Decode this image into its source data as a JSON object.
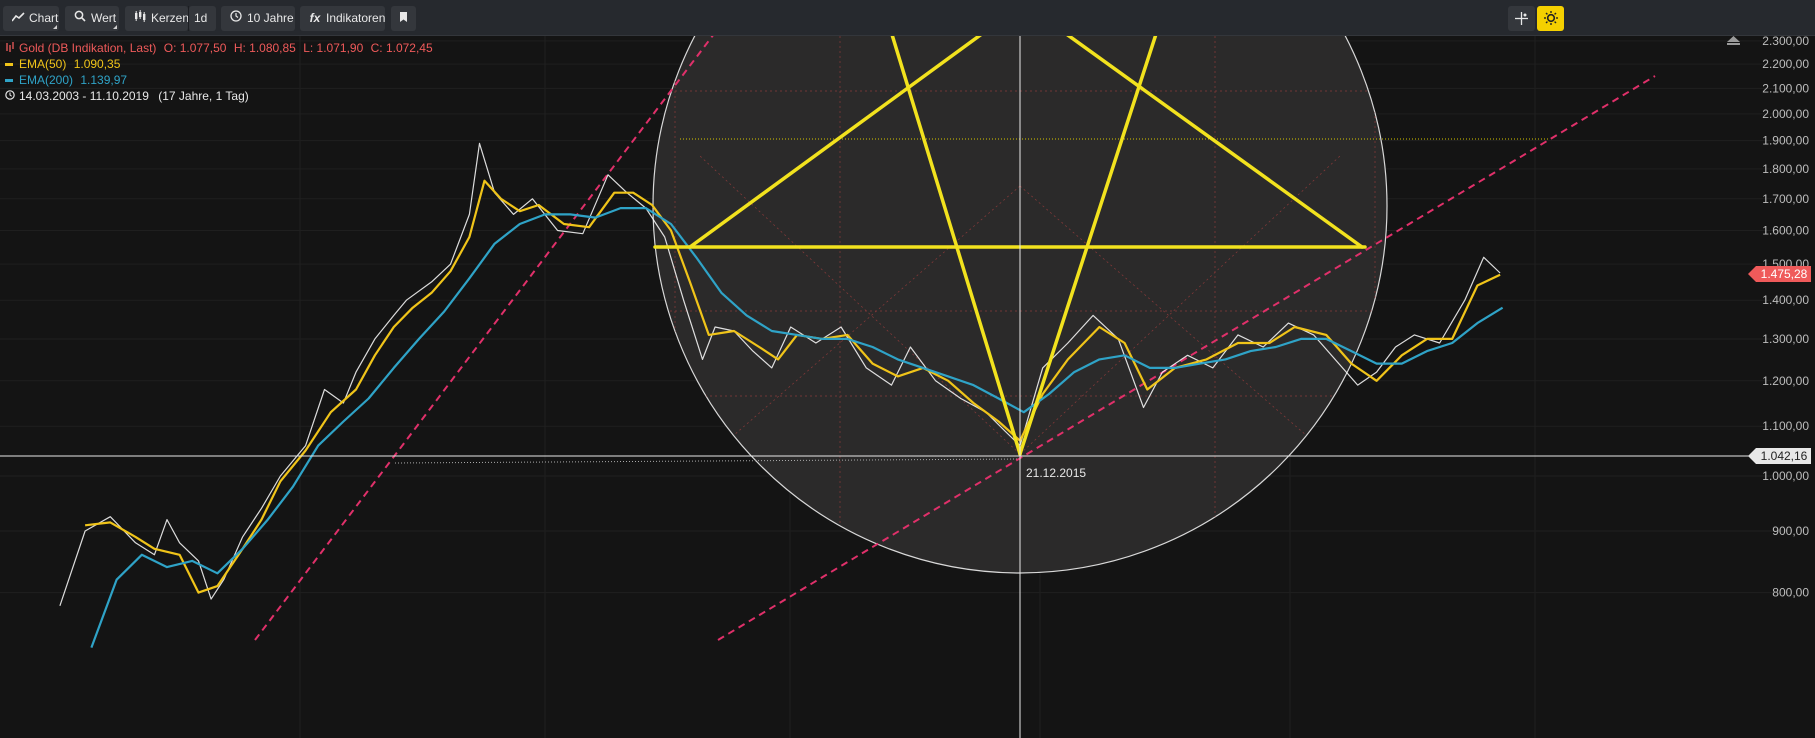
{
  "toolbar": {
    "chart_label": "Chart",
    "value_label": "Wert",
    "candles_label": "Kerzen",
    "interval_label": "1d",
    "period_label": "10 Jahre",
    "indicators_label": "Indikatoren",
    "accent_color": "#f5d000"
  },
  "legend": {
    "instrument": "Gold (DB Indikation, Last)",
    "open": "O: 1.077,50",
    "high": "H: 1.080,85",
    "low": "L: 1.071,90",
    "close": "C: 1.072,45",
    "ema50_label": "EMA(50)",
    "ema50_value": "1.090,35",
    "ema50_color": "#f0c419",
    "ema200_label": "EMA(200)",
    "ema200_value": "1.139,97",
    "ema200_color": "#2fa3c7",
    "range": "14.03.2003 - 11.10.2019",
    "range_span": "(17 Jahre, 1 Tag)",
    "price_color": "#ef5a5a"
  },
  "chart_data": {
    "type": "line",
    "y_axis": {
      "ticks": [
        2300,
        2200,
        2100,
        2000,
        1900,
        1800,
        1700,
        1600,
        1500,
        1400,
        1300,
        1200,
        1100,
        1000,
        900,
        800
      ],
      "tick_labels": [
        "2.300,00",
        "2.200,00",
        "2.100,00",
        "2.000,00",
        "1.900,00",
        "1.800,00",
        "1.700,00",
        "1.600,00",
        "1.500,00",
        "1.400,00",
        "1.300,00",
        "1.200,00",
        "1.100,00",
        "1.000,00",
        "900,00",
        "800,00"
      ],
      "scale": "log",
      "position": "right"
    },
    "current_price": {
      "value": 1475.28,
      "label": "1.475,28",
      "color": "#ef5a5a"
    },
    "crosshair": {
      "value": 1042.16,
      "label": "1.042,16",
      "date_label": "21.12.2015"
    },
    "series": [
      {
        "name": "Gold (DB Indikation, Last)",
        "color": "#ffffff",
        "values": [
          [
            2008.35,
            780
          ],
          [
            2008.55,
            900
          ],
          [
            2008.75,
            925
          ],
          [
            2008.95,
            880
          ],
          [
            2009.1,
            860
          ],
          [
            2009.2,
            920
          ],
          [
            2009.3,
            880
          ],
          [
            2009.45,
            850
          ],
          [
            2009.55,
            790
          ],
          [
            2009.65,
            820
          ],
          [
            2009.8,
            890
          ],
          [
            2009.95,
            940
          ],
          [
            2010.1,
            1000
          ],
          [
            2010.3,
            1060
          ],
          [
            2010.45,
            1180
          ],
          [
            2010.6,
            1150
          ],
          [
            2010.7,
            1220
          ],
          [
            2010.85,
            1300
          ],
          [
            2011.0,
            1360
          ],
          [
            2011.1,
            1400
          ],
          [
            2011.3,
            1450
          ],
          [
            2011.45,
            1500
          ],
          [
            2011.6,
            1650
          ],
          [
            2011.68,
            1890
          ],
          [
            2011.8,
            1720
          ],
          [
            2011.95,
            1650
          ],
          [
            2012.1,
            1700
          ],
          [
            2012.3,
            1600
          ],
          [
            2012.5,
            1590
          ],
          [
            2012.7,
            1780
          ],
          [
            2012.85,
            1720
          ],
          [
            2013.0,
            1670
          ],
          [
            2013.15,
            1580
          ],
          [
            2013.3,
            1400
          ],
          [
            2013.45,
            1250
          ],
          [
            2013.55,
            1330
          ],
          [
            2013.7,
            1320
          ],
          [
            2013.85,
            1270
          ],
          [
            2014.0,
            1230
          ],
          [
            2014.15,
            1330
          ],
          [
            2014.35,
            1290
          ],
          [
            2014.55,
            1330
          ],
          [
            2014.75,
            1230
          ],
          [
            2014.95,
            1190
          ],
          [
            2015.1,
            1280
          ],
          [
            2015.3,
            1200
          ],
          [
            2015.5,
            1160
          ],
          [
            2015.7,
            1130
          ],
          [
            2015.85,
            1090
          ],
          [
            2015.97,
            1060
          ],
          [
            2016.15,
            1230
          ],
          [
            2016.35,
            1290
          ],
          [
            2016.55,
            1360
          ],
          [
            2016.75,
            1300
          ],
          [
            2016.95,
            1140
          ],
          [
            2017.1,
            1220
          ],
          [
            2017.3,
            1260
          ],
          [
            2017.5,
            1230
          ],
          [
            2017.7,
            1310
          ],
          [
            2017.9,
            1280
          ],
          [
            2018.1,
            1340
          ],
          [
            2018.3,
            1310
          ],
          [
            2018.5,
            1240
          ],
          [
            2018.65,
            1190
          ],
          [
            2018.8,
            1220
          ],
          [
            2018.95,
            1280
          ],
          [
            2019.1,
            1310
          ],
          [
            2019.3,
            1290
          ],
          [
            2019.5,
            1400
          ],
          [
            2019.65,
            1520
          ],
          [
            2019.78,
            1475
          ]
        ]
      },
      {
        "name": "EMA(50)",
        "color": "#f0c419",
        "values": [
          [
            2008.55,
            910
          ],
          [
            2008.75,
            915
          ],
          [
            2008.95,
            890
          ],
          [
            2009.1,
            870
          ],
          [
            2009.3,
            860
          ],
          [
            2009.45,
            800
          ],
          [
            2009.6,
            810
          ],
          [
            2009.8,
            870
          ],
          [
            2009.95,
            920
          ],
          [
            2010.1,
            990
          ],
          [
            2010.3,
            1050
          ],
          [
            2010.5,
            1130
          ],
          [
            2010.7,
            1180
          ],
          [
            2010.85,
            1260
          ],
          [
            2011.0,
            1330
          ],
          [
            2011.15,
            1380
          ],
          [
            2011.3,
            1420
          ],
          [
            2011.45,
            1480
          ],
          [
            2011.6,
            1580
          ],
          [
            2011.72,
            1760
          ],
          [
            2011.85,
            1700
          ],
          [
            2012.0,
            1660
          ],
          [
            2012.15,
            1680
          ],
          [
            2012.35,
            1620
          ],
          [
            2012.55,
            1610
          ],
          [
            2012.75,
            1720
          ],
          [
            2012.9,
            1720
          ],
          [
            2013.05,
            1680
          ],
          [
            2013.2,
            1600
          ],
          [
            2013.35,
            1450
          ],
          [
            2013.5,
            1310
          ],
          [
            2013.7,
            1320
          ],
          [
            2013.9,
            1280
          ],
          [
            2014.05,
            1250
          ],
          [
            2014.2,
            1310
          ],
          [
            2014.4,
            1300
          ],
          [
            2014.6,
            1310
          ],
          [
            2014.8,
            1240
          ],
          [
            2015.0,
            1210
          ],
          [
            2015.2,
            1230
          ],
          [
            2015.4,
            1200
          ],
          [
            2015.6,
            1150
          ],
          [
            2015.8,
            1110
          ],
          [
            2015.97,
            1070
          ],
          [
            2016.15,
            1170
          ],
          [
            2016.35,
            1250
          ],
          [
            2016.6,
            1330
          ],
          [
            2016.8,
            1290
          ],
          [
            2016.98,
            1180
          ],
          [
            2017.2,
            1230
          ],
          [
            2017.45,
            1250
          ],
          [
            2017.7,
            1290
          ],
          [
            2017.95,
            1290
          ],
          [
            2018.15,
            1330
          ],
          [
            2018.4,
            1310
          ],
          [
            2018.6,
            1240
          ],
          [
            2018.8,
            1200
          ],
          [
            2019.0,
            1260
          ],
          [
            2019.2,
            1300
          ],
          [
            2019.4,
            1300
          ],
          [
            2019.6,
            1440
          ],
          [
            2019.78,
            1470
          ]
        ]
      },
      {
        "name": "EMA(200)",
        "color": "#2fa3c7",
        "values": [
          [
            2008.6,
            720
          ],
          [
            2008.8,
            820
          ],
          [
            2009.0,
            860
          ],
          [
            2009.2,
            840
          ],
          [
            2009.4,
            850
          ],
          [
            2009.6,
            830
          ],
          [
            2009.8,
            870
          ],
          [
            2010.0,
            920
          ],
          [
            2010.2,
            980
          ],
          [
            2010.4,
            1060
          ],
          [
            2010.6,
            1110
          ],
          [
            2010.8,
            1160
          ],
          [
            2011.0,
            1230
          ],
          [
            2011.2,
            1300
          ],
          [
            2011.4,
            1370
          ],
          [
            2011.6,
            1460
          ],
          [
            2011.8,
            1560
          ],
          [
            2012.0,
            1620
          ],
          [
            2012.2,
            1650
          ],
          [
            2012.4,
            1650
          ],
          [
            2012.6,
            1640
          ],
          [
            2012.8,
            1670
          ],
          [
            2013.0,
            1670
          ],
          [
            2013.2,
            1620
          ],
          [
            2013.4,
            1520
          ],
          [
            2013.6,
            1420
          ],
          [
            2013.8,
            1360
          ],
          [
            2014.0,
            1320
          ],
          [
            2014.2,
            1310
          ],
          [
            2014.4,
            1300
          ],
          [
            2014.6,
            1300
          ],
          [
            2014.8,
            1280
          ],
          [
            2015.0,
            1250
          ],
          [
            2015.2,
            1230
          ],
          [
            2015.4,
            1210
          ],
          [
            2015.6,
            1190
          ],
          [
            2015.8,
            1160
          ],
          [
            2016.0,
            1130
          ],
          [
            2016.2,
            1170
          ],
          [
            2016.4,
            1220
          ],
          [
            2016.6,
            1250
          ],
          [
            2016.8,
            1260
          ],
          [
            2017.0,
            1230
          ],
          [
            2017.2,
            1230
          ],
          [
            2017.4,
            1240
          ],
          [
            2017.6,
            1250
          ],
          [
            2017.8,
            1270
          ],
          [
            2018.0,
            1280
          ],
          [
            2018.2,
            1300
          ],
          [
            2018.4,
            1300
          ],
          [
            2018.6,
            1270
          ],
          [
            2018.8,
            1240
          ],
          [
            2019.0,
            1240
          ],
          [
            2019.2,
            1270
          ],
          [
            2019.4,
            1290
          ],
          [
            2019.6,
            1340
          ],
          [
            2019.8,
            1380
          ]
        ]
      }
    ]
  }
}
